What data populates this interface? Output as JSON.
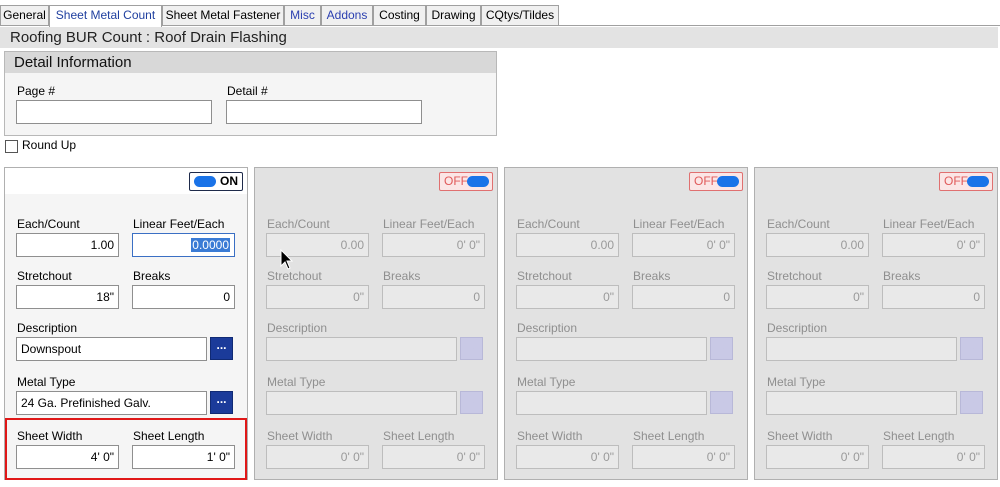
{
  "tabs": [
    {
      "label": "General"
    },
    {
      "label": "Sheet Metal Count"
    },
    {
      "label": "Sheet Metal Fastener"
    },
    {
      "label": "Misc"
    },
    {
      "label": "Addons"
    },
    {
      "label": "Costing"
    },
    {
      "label": "Drawing"
    },
    {
      "label": "CQtys/Tildes"
    }
  ],
  "header": {
    "title": "Roofing BUR Count : Roof Drain Flashing"
  },
  "detail": {
    "title": "Detail Information",
    "page_label": "Page #",
    "page_value": "",
    "detail_label": "Detail #",
    "detail_value": ""
  },
  "round_up": {
    "label": "Round Up",
    "checked": false
  },
  "labels": {
    "each_count": "Each/Count",
    "linear_feet": "Linear Feet/Each",
    "stretchout": "Stretchout",
    "breaks": "Breaks",
    "description": "Description",
    "metal_type": "Metal Type",
    "sheet_width": "Sheet Width",
    "sheet_length": "Sheet Length",
    "ellipsis": "..."
  },
  "panels": [
    {
      "toggle": "ON",
      "each_count": "1.00",
      "linear_feet": "0.0000",
      "stretchout": "18\"",
      "breaks": "0",
      "description": "Downspout",
      "metal_type": "24 Ga. Prefinished Galv.",
      "sheet_width": "4' 0\"",
      "sheet_length": "1' 0\""
    },
    {
      "toggle": "OFF",
      "each_count": "0.00",
      "linear_feet": "0' 0\"",
      "stretchout": "0\"",
      "breaks": "0",
      "description": "",
      "metal_type": "",
      "sheet_width": "0' 0\"",
      "sheet_length": "0' 0\""
    },
    {
      "toggle": "OFF",
      "each_count": "0.00",
      "linear_feet": "0' 0\"",
      "stretchout": "0\"",
      "breaks": "0",
      "description": "",
      "metal_type": "",
      "sheet_width": "0' 0\"",
      "sheet_length": "0' 0\""
    },
    {
      "toggle": "OFF",
      "each_count": "0.00",
      "linear_feet": "0' 0\"",
      "stretchout": "0\"",
      "breaks": "0",
      "description": "",
      "metal_type": "",
      "sheet_width": "0' 0\"",
      "sheet_length": "0' 0\""
    }
  ],
  "colors": {
    "accent": "#1b3b9a",
    "toggle_knob": "#1a73e8",
    "highlight": "#e01818"
  },
  "icons": {
    "cursor": "arrow-cursor-icon"
  }
}
